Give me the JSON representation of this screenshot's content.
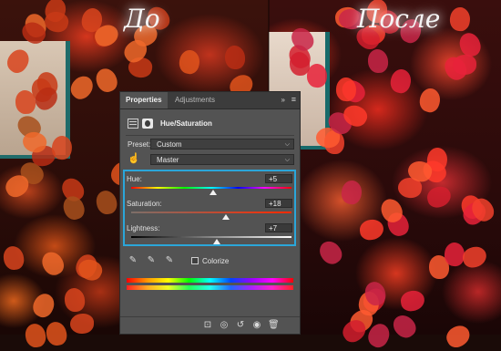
{
  "captions": {
    "before": "До",
    "after": "После"
  },
  "panel": {
    "tabs": {
      "properties": "Properties",
      "adjustments": "Adjustments",
      "menu_glyph": "»",
      "hamburger_glyph": "≡"
    },
    "title": "Hue/Saturation",
    "preset": {
      "label": "Preset:",
      "value": "Custom"
    },
    "channel": {
      "value": "Master"
    },
    "sliders": {
      "hue": {
        "label": "Hue:",
        "value": "+5",
        "level": 0.51
      },
      "saturation": {
        "label": "Saturation:",
        "value": "+18",
        "level": 0.59
      },
      "lightness": {
        "label": "Lightness:",
        "value": "+7",
        "level": 0.535
      }
    },
    "colorize": {
      "label": "Colorize",
      "checked": false
    },
    "colors": {
      "highlight": "#2ba6d9",
      "panel_bg": "#535353"
    }
  }
}
